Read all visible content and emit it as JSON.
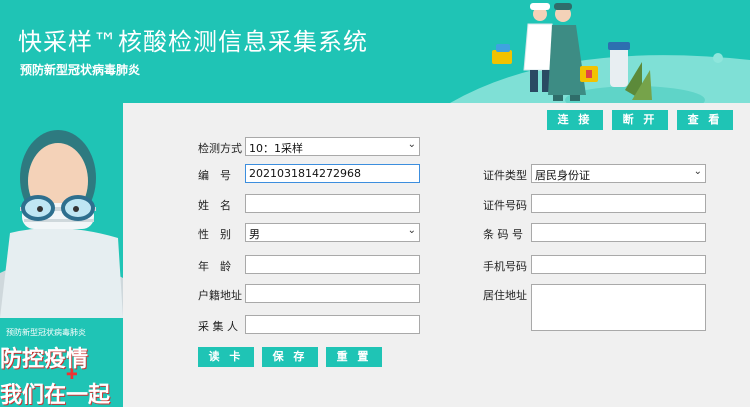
{
  "header": {
    "title": "快采样™核酸检测信息采集系统",
    "subtitle": "预防新型冠状病毒肺炎"
  },
  "poster": {
    "small_text": "预防新型冠状病毒肺炎",
    "line1": "防控疫情",
    "line2": "我们在一起"
  },
  "toolbar": {
    "connect": "连 接",
    "disconnect": "断 开",
    "view": "查 看"
  },
  "form": {
    "method_label": "检测方式",
    "method_value": "10：1采样",
    "number_label": "编　号",
    "number_value": "2021031814272968",
    "id_type_label": "证件类型",
    "id_type_value": "居民身份证",
    "name_label": "姓　名",
    "name_value": "",
    "id_no_label": "证件号码",
    "id_no_value": "",
    "gender_label": "性　别",
    "gender_value": "男",
    "barcode_label": "条 码 号",
    "barcode_value": "",
    "age_label": "年　龄",
    "age_value": "",
    "phone_label": "手机号码",
    "phone_value": "",
    "household_label": "户籍地址",
    "household_value": "",
    "residence_label": "居住地址",
    "residence_value": "",
    "collector_label": "采 集 人",
    "collector_value": ""
  },
  "actions": {
    "read_card": "读 卡",
    "save": "保 存",
    "reset": "重 置"
  }
}
